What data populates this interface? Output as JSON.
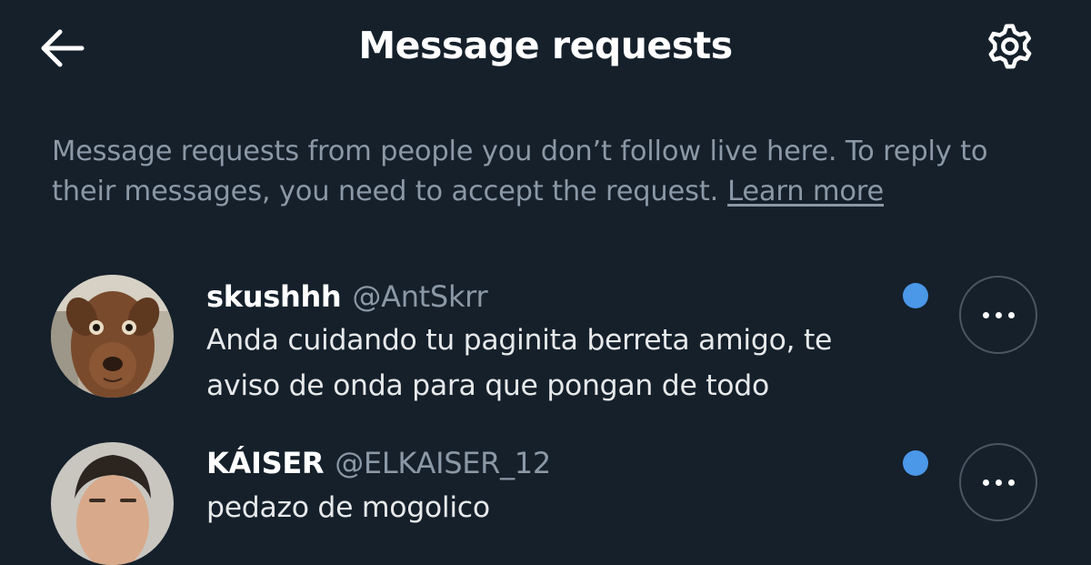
{
  "header": {
    "title": "Message requests",
    "back_icon": "arrow-left-icon",
    "settings_icon": "gear-icon"
  },
  "info": {
    "text": "Message requests from people you don’t follow live here. To reply to their messages, you need to accept the request.",
    "link_label": "Learn more"
  },
  "requests": [
    {
      "name": "skushhh",
      "handle": "@AntSkrr",
      "message": "Anda cuidando tu paginita berreta amigo, te aviso de onda para que pongan de todo",
      "unread": true
    },
    {
      "name": "KÁISER",
      "handle": "@ELKAISER_12",
      "message": "pedazo de mogolico",
      "unread": true
    }
  ],
  "colors": {
    "background": "#15202b",
    "secondary_text": "#8b98a5",
    "unread_dot": "#4b97e8"
  }
}
